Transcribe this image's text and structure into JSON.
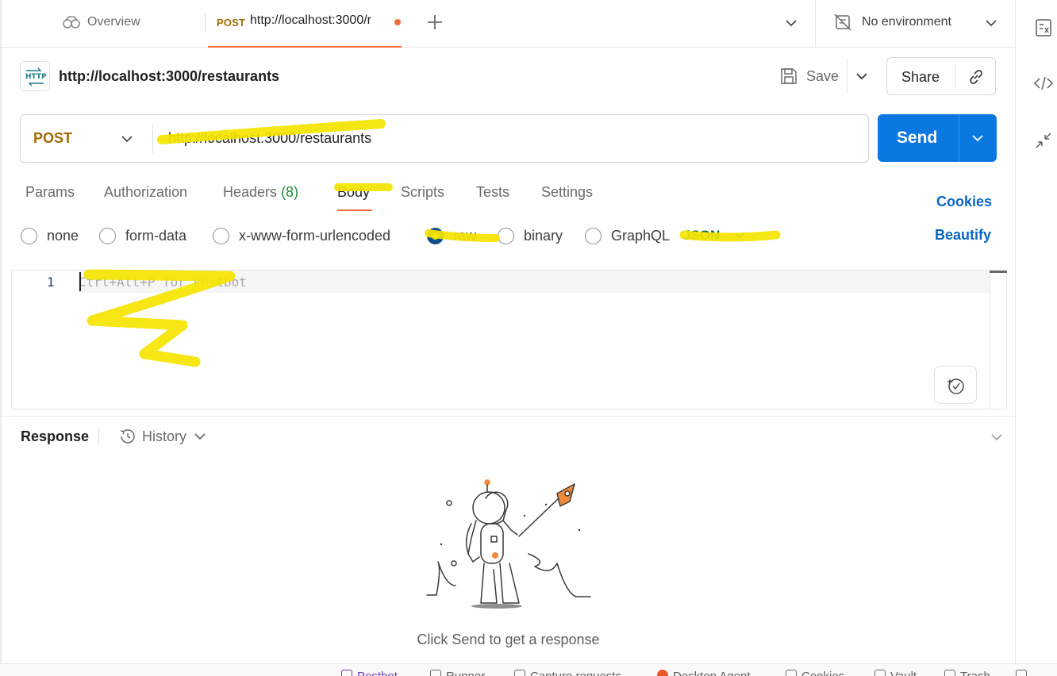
{
  "tabs": {
    "overview_label": "Overview",
    "active_method": "POST",
    "active_url": "http://localhost:3000/r"
  },
  "environment": {
    "label": "No environment"
  },
  "request": {
    "title": "http://localhost:3000/restaurants",
    "save_label": "Save",
    "share_label": "Share",
    "method": "POST",
    "url": "http://localhost:3000/restaurants",
    "send_label": "Send"
  },
  "request_tabs": {
    "params": "Params",
    "authorization": "Authorization",
    "headers": "Headers",
    "headers_count": "(8)",
    "body": "Body",
    "scripts": "Scripts",
    "tests": "Tests",
    "settings": "Settings",
    "cookies": "Cookies"
  },
  "body_types": {
    "none": "none",
    "form_data": "form-data",
    "urlencoded": "x-www-form-urlencoded",
    "raw": "raw",
    "binary": "binary",
    "graphql": "GraphQL",
    "selected": "raw",
    "format": "JSON",
    "beautify": "Beautify"
  },
  "editor": {
    "line_number": "1",
    "placeholder": "Ctrl+Alt+P for Postbot"
  },
  "response": {
    "title": "Response",
    "history_label": "History",
    "empty_message": "Click Send to get a response"
  },
  "statusbar": {
    "postbot": "Postbot",
    "runner": "Runner",
    "capture": "Capture requests",
    "agent": "Desktop Agent",
    "cookies": "Cookies",
    "vault": "Vault",
    "trash": "Trash"
  },
  "colors": {
    "accent_orange": "#ff6c37",
    "send_blue": "#0a78e0",
    "method_post": "#a06b00",
    "link_blue": "#0a66c2",
    "highlight_yellow": "#f4e400"
  }
}
